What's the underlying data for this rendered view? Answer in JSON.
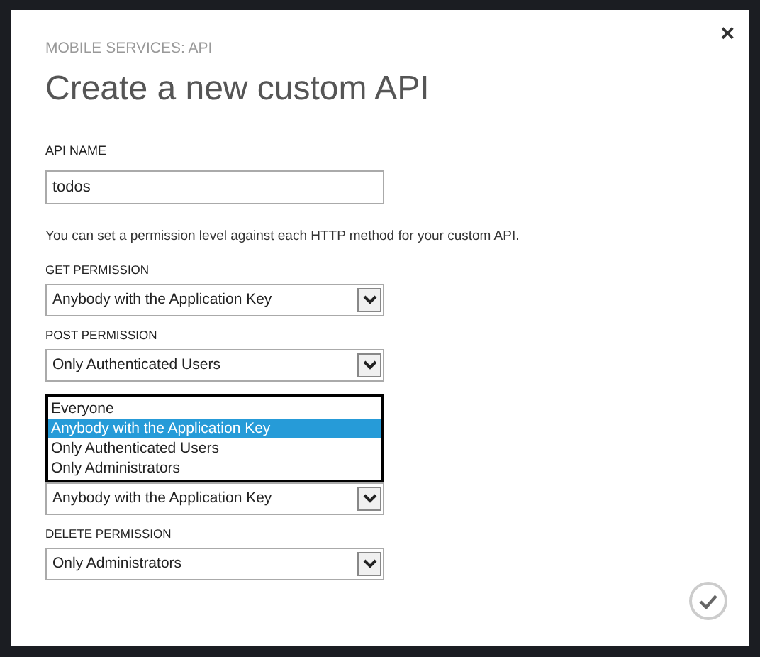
{
  "dialog": {
    "section": "MOBILE SERVICES: API",
    "title": "Create a new custom API",
    "close": "×"
  },
  "api_name": {
    "label": "API NAME",
    "value": "todos"
  },
  "description": "You can set a permission level against each HTTP method for your custom API.",
  "permissions": [
    {
      "label": "GET PERMISSION",
      "value": "Anybody with the Application Key",
      "open": false
    },
    {
      "label": "POST PERMISSION",
      "value": "Only Authenticated Users",
      "open": false
    },
    {
      "value": "Anybody with the Application Key",
      "open": true,
      "options": [
        {
          "label": "Everyone",
          "selected": false
        },
        {
          "label": "Anybody with the Application Key",
          "selected": true
        },
        {
          "label": "Only Authenticated Users",
          "selected": false
        },
        {
          "label": "Only Administrators",
          "selected": false
        }
      ]
    },
    {
      "label": "DELETE PERMISSION",
      "value": "Only Administrators",
      "open": false
    }
  ]
}
